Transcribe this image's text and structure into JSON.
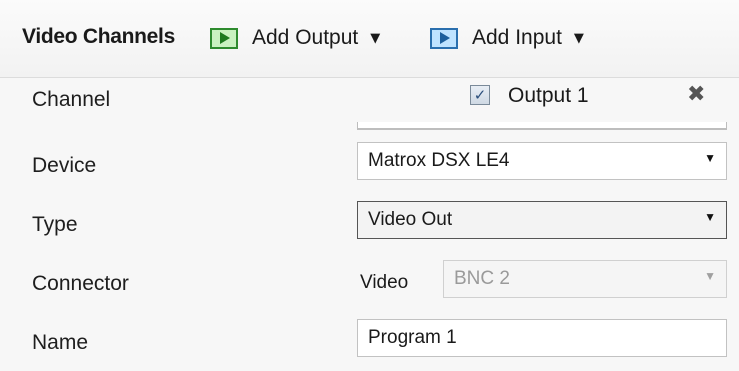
{
  "toolbar": {
    "title": "Video Channels",
    "add_output_label": "Add Output",
    "add_input_label": "Add Input"
  },
  "form": {
    "labels": {
      "channel": "Channel",
      "device": "Device",
      "type": "Type",
      "connector": "Connector",
      "name": "Name"
    },
    "output": {
      "checked": true,
      "label": "Output 1"
    },
    "device_value": "Matrox DSX LE4",
    "type_value": "Video Out",
    "connector_prefix": "Video",
    "connector_value": "BNC 2",
    "name_value": "Program 1"
  },
  "icons": {
    "add_output": "play-green-icon",
    "add_input": "play-blue-icon",
    "close": "close-x-icon",
    "dropdown": "chevron-down-icon",
    "checkbox": "checkbox-checked-icon"
  },
  "colors": {
    "output_icon_border": "#2e8b2e",
    "output_icon_fill": "#c9f2c0",
    "input_icon_border": "#2a6fae",
    "input_icon_fill": "#bfe3ff"
  }
}
